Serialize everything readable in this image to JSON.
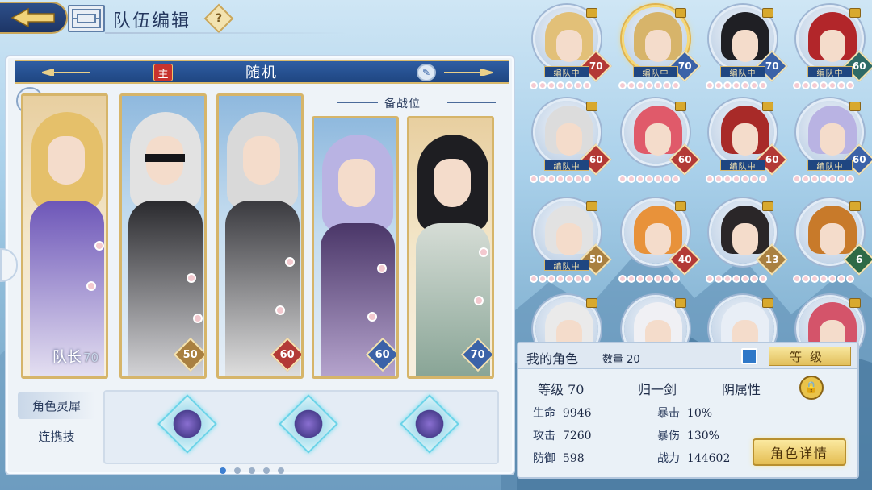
{
  "header": {
    "title": "队伍编辑",
    "help_icon": "?"
  },
  "team": {
    "name": "随机",
    "main_tag": "主",
    "reserve_label": "备战位",
    "leader_label": "队长",
    "members": [
      {
        "level": "70",
        "hair": "#e5c06a",
        "body": "#6d56b8",
        "bg": "gold"
      },
      {
        "level": "50",
        "hair": "#e2e2e2",
        "body": "#2a2a2e",
        "bg": "blue"
      },
      {
        "level": "60",
        "hair": "#d9d9d9",
        "body": "#3a3a3f",
        "bg": "blue"
      },
      {
        "level": "60",
        "hair": "#b9b3e3",
        "body": "#4a3668",
        "bg": "blue"
      },
      {
        "level": "70",
        "hair": "#1e1e22",
        "body": "#d6ddd6",
        "bg": "gold"
      }
    ],
    "tabs": [
      "角色灵犀",
      "连携技"
    ]
  },
  "roster": {
    "in_team_label": "编队中",
    "items": [
      {
        "level": "70",
        "in_team": true,
        "hair": "#e2c078",
        "lv_color": "#b33a36"
      },
      {
        "level": "70",
        "in_team": true,
        "hair": "#d7b46a",
        "lv_color": "#3b62a8",
        "selected": true
      },
      {
        "level": "70",
        "in_team": true,
        "hair": "#1f1f24",
        "lv_color": "#3b62a8"
      },
      {
        "level": "60",
        "in_team": true,
        "hair": "#b2262a",
        "lv_color": "#2e6a66"
      },
      {
        "level": "60",
        "in_team": true,
        "hair": "#dcdcdc",
        "lv_color": "#b33a36"
      },
      {
        "level": "60",
        "in_team": false,
        "hair": "#e05a6a",
        "lv_color": "#b33a36"
      },
      {
        "level": "60",
        "in_team": true,
        "hair": "#a82a28",
        "lv_color": "#b33a36"
      },
      {
        "level": "60",
        "in_team": true,
        "hair": "#b9b3e3",
        "lv_color": "#3b62a8"
      },
      {
        "level": "50",
        "in_team": true,
        "hair": "#e2e2e2",
        "lv_color": "#a98040"
      },
      {
        "level": "40",
        "in_team": false,
        "hair": "#e8923a",
        "lv_color": "#b33a36"
      },
      {
        "level": "13",
        "in_team": false,
        "hair": "#2a2628",
        "lv_color": "#a98040"
      },
      {
        "level": "6",
        "in_team": false,
        "hair": "#c87a2a",
        "lv_color": "#2e6a46"
      },
      {
        "level": "",
        "in_team": false,
        "hair": "#eaeaea",
        "lv_color": "#a98040"
      },
      {
        "level": "",
        "in_team": false,
        "hair": "#f0f0f4",
        "lv_color": "#a98040"
      },
      {
        "level": "",
        "in_team": false,
        "hair": "#e8eef6",
        "lv_color": "#a98040"
      },
      {
        "level": "",
        "in_team": false,
        "hair": "#d4546a",
        "lv_color": "#a98040"
      }
    ]
  },
  "info": {
    "my_characters": "我的角色",
    "count_label": "数量 20",
    "sort_label": "等级",
    "level_text": "等级 70",
    "sect": "归一剑",
    "attribute": "阴属性",
    "stats": {
      "hp_label": "生命",
      "hp": "9946",
      "atk_label": "攻击",
      "atk": "7260",
      "def_label": "防御",
      "def": "598",
      "crit_label": "暴击",
      "crit": "10%",
      "critdmg_label": "暴伤",
      "critdmg": "130%",
      "power_label": "战力",
      "power": "144602"
    },
    "detail_button": "角色详情"
  }
}
